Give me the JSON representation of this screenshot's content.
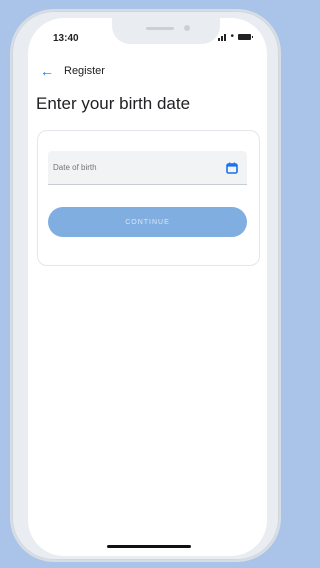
{
  "status_bar": {
    "time": "13:40"
  },
  "header": {
    "back_label": "←",
    "title": "Register"
  },
  "page": {
    "title": "Enter your birth date"
  },
  "form": {
    "birth_date": {
      "placeholder": "Date of birth",
      "value": ""
    },
    "continue_label": "CONTINUE"
  },
  "colors": {
    "accent": "#1a73e8",
    "button_disabled": "#80aee0",
    "background": "#a9c4e8"
  },
  "icons": {
    "back": "arrow-left-icon",
    "calendar": "calendar-icon",
    "signal": "signal-icon",
    "wifi": "wifi-icon",
    "battery": "battery-icon"
  }
}
